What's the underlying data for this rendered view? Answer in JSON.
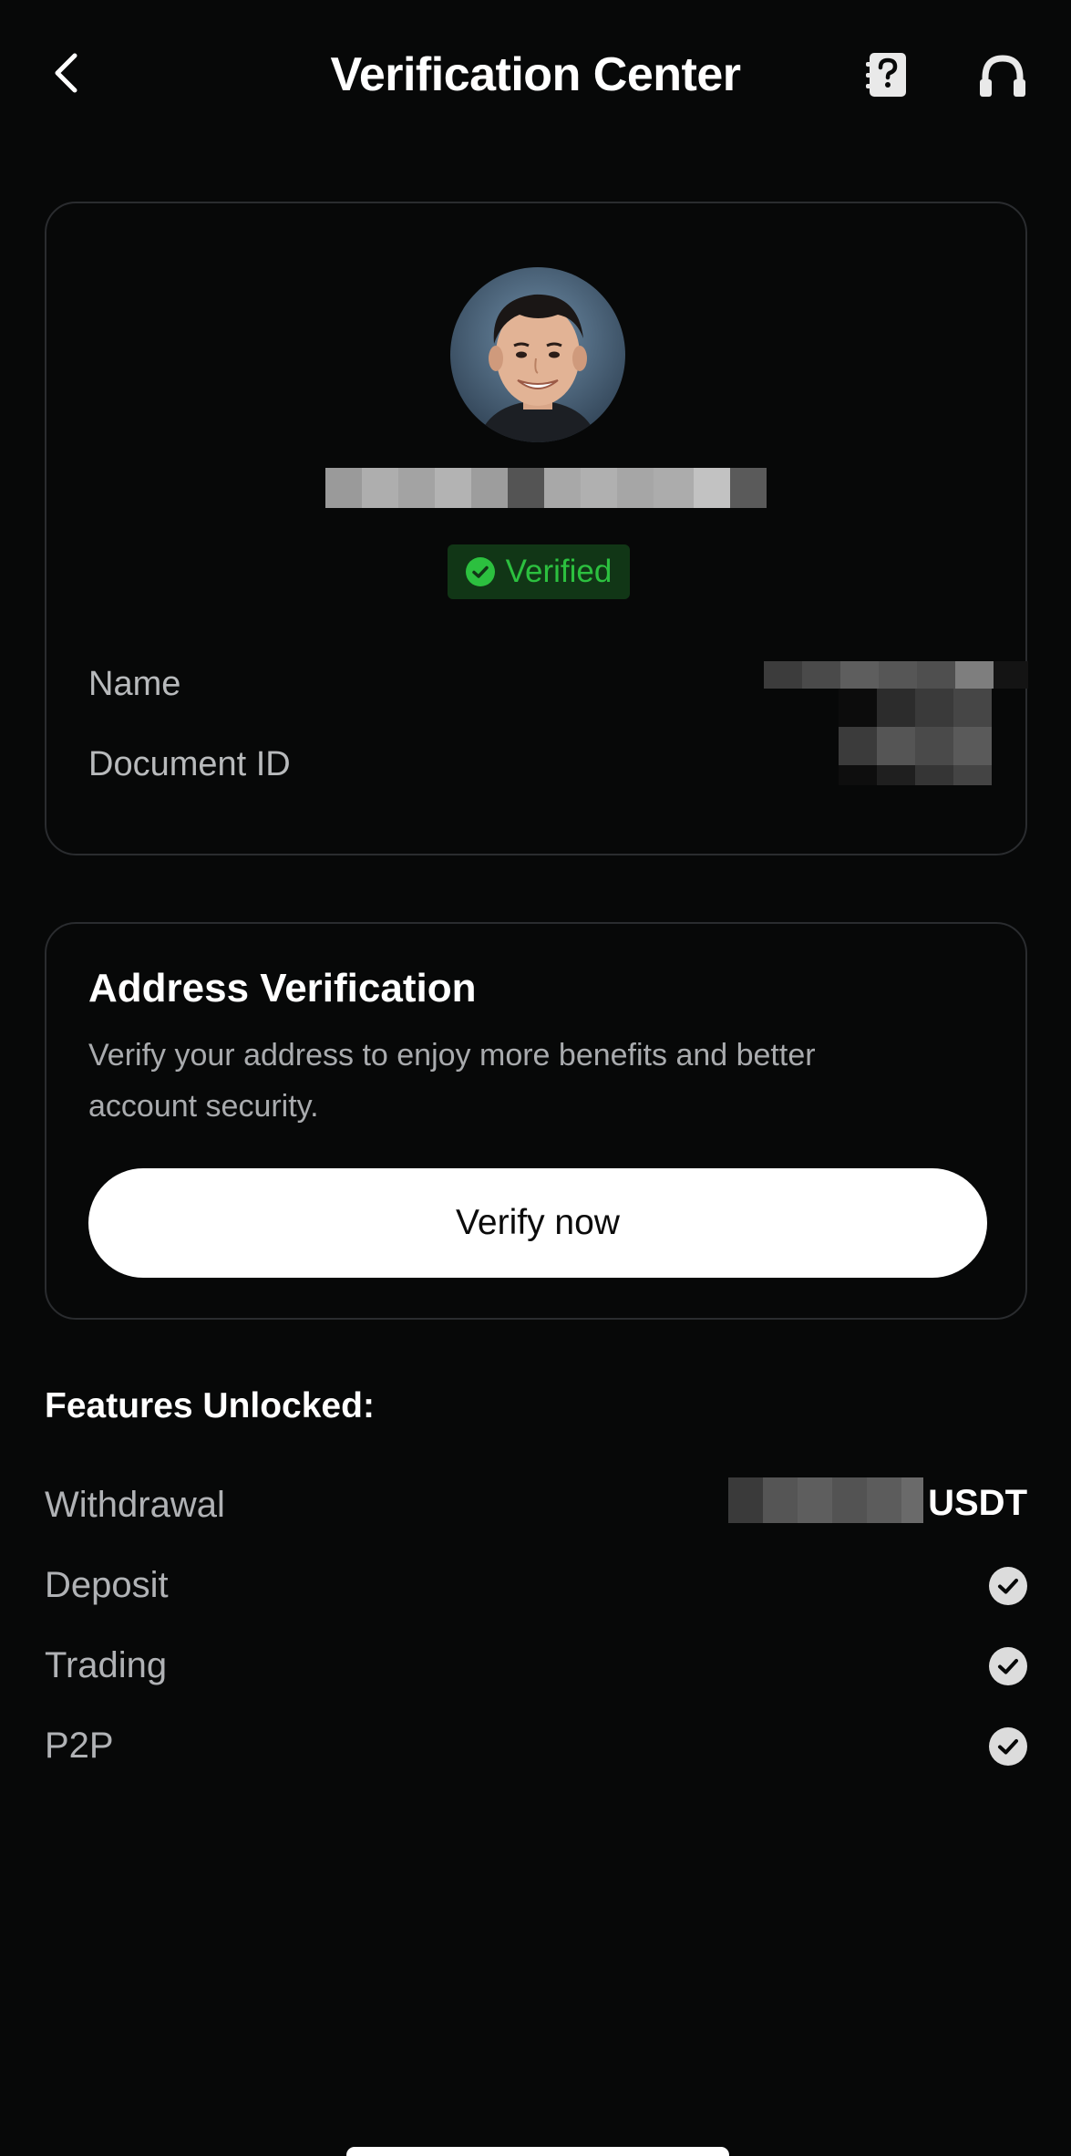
{
  "header": {
    "title": "Verification Center",
    "back_icon": "chevron-left-icon",
    "help_icon": "help-book-icon",
    "support_icon": "headset-icon"
  },
  "identity": {
    "status": "Verified",
    "status_color": "#2cc03f",
    "fields": [
      {
        "label": "Name"
      },
      {
        "label": "Document ID"
      }
    ]
  },
  "address_verification": {
    "title": "Address Verification",
    "description": "Verify your address to enjoy more benefits and better account security.",
    "button_label": "Verify now"
  },
  "features": {
    "heading": "Features Unlocked:",
    "withdrawal": {
      "label": "Withdrawal",
      "unit": "USDT"
    },
    "items": [
      {
        "label": "Deposit",
        "icon": "check-circle-icon"
      },
      {
        "label": "Trading",
        "icon": "check-circle-icon"
      },
      {
        "label": "P2P",
        "icon": "check-circle-icon"
      }
    ]
  }
}
